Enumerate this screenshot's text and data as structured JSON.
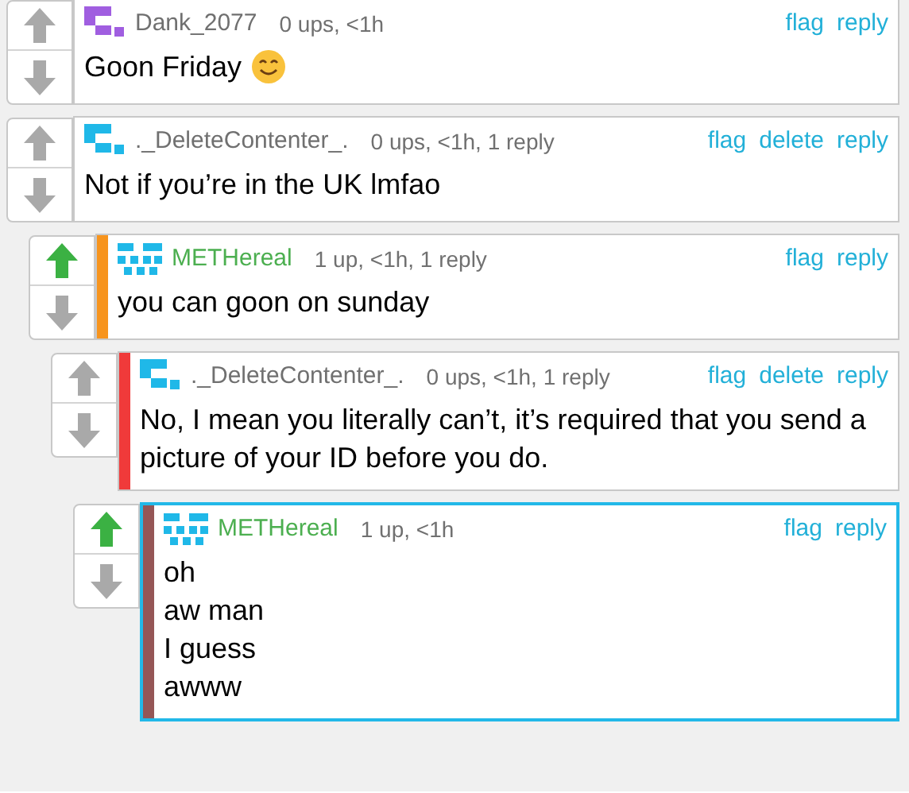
{
  "comments": [
    {
      "user": "Dank_2077",
      "op": false,
      "avatar": {
        "kind": "block",
        "color": "#a05ee0"
      },
      "meta": "0 ups, <1h",
      "upvoted": false,
      "actions": [
        "flag",
        "reply"
      ],
      "body": [
        "Goon Friday"
      ],
      "emoji": true,
      "highlighted": false
    },
    {
      "user": "._DeleteContenter_.",
      "op": false,
      "avatar": {
        "kind": "block",
        "color": "#1fb8e8"
      },
      "meta": "0 ups, <1h, 1 reply",
      "upvoted": false,
      "actions": [
        "flag",
        "delete",
        "reply"
      ],
      "body": [
        "Not if you’re in the UK lmfao"
      ],
      "emoji": false,
      "highlighted": false,
      "children": [
        {
          "user": "METHereal",
          "op": true,
          "avatar": {
            "kind": "checker",
            "color": "#1fb8e8"
          },
          "meta": "1 up, <1h, 1 reply",
          "upvoted": true,
          "color": "#f7941d",
          "actions": [
            "flag",
            "reply"
          ],
          "body": [
            "you can goon on sunday"
          ],
          "emoji": false,
          "highlighted": false,
          "children": [
            {
              "user": "._DeleteContenter_.",
              "op": false,
              "avatar": {
                "kind": "block",
                "color": "#1fb8e8"
              },
              "meta": "0 ups, <1h, 1 reply",
              "upvoted": false,
              "color": "#f03a3a",
              "actions": [
                "flag",
                "delete",
                "reply"
              ],
              "body": [
                "No, I mean you literally can’t, it’s required that you send a picture of your ID before you do."
              ],
              "emoji": false,
              "highlighted": false,
              "children": [
                {
                  "user": "METHereal",
                  "op": true,
                  "avatar": {
                    "kind": "checker",
                    "color": "#1fb8e8"
                  },
                  "meta": "1 up, <1h",
                  "upvoted": true,
                  "color": "#955656",
                  "actions": [
                    "flag",
                    "reply"
                  ],
                  "body": [
                    "oh",
                    "aw man",
                    "I guess",
                    "awww"
                  ],
                  "emoji": false,
                  "highlighted": true
                }
              ]
            }
          ]
        }
      ]
    }
  ]
}
